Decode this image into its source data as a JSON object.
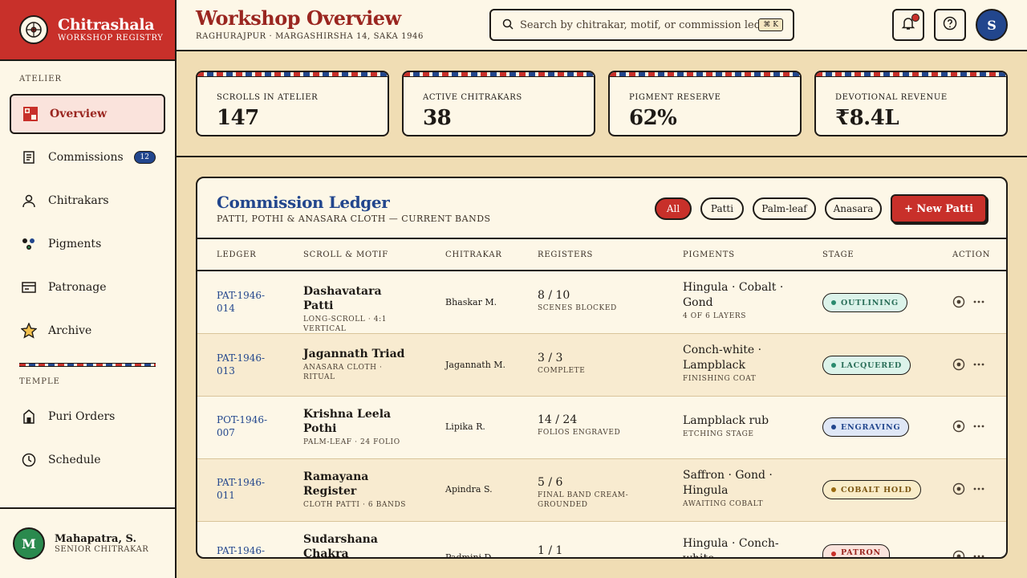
{
  "brand": {
    "title": "Chitrashala",
    "subtitle": "WORKSHOP REGISTRY"
  },
  "sidebar": {
    "section_atelier": "ATELIER",
    "section_temple": "TEMPLE",
    "items": [
      {
        "label": "Overview",
        "icon": "grid-icon"
      },
      {
        "label": "Commissions",
        "icon": "scroll-icon",
        "badge": "12"
      },
      {
        "label": "Chitrakars",
        "icon": "user-icon"
      },
      {
        "label": "Pigments",
        "icon": "pigment-dots-icon"
      },
      {
        "label": "Patronage",
        "icon": "card-icon"
      },
      {
        "label": "Archive",
        "icon": "star-icon"
      },
      {
        "label": "Puri Orders",
        "icon": "temple-icon"
      },
      {
        "label": "Schedule",
        "icon": "clock-icon"
      }
    ],
    "user": {
      "initial": "M",
      "name": "Mahapatra, S.",
      "role": "SENIOR CHITRAKAR"
    }
  },
  "header": {
    "title": "Workshop Overview",
    "subtitle": "RAGHURAJPUR · MARGASHIRSHA 14, SAKA 1946",
    "search_placeholder": "Search by chitrakar, motif, or commission ledger...",
    "search_shortcut": "⌘ K",
    "avatar_initial": "S"
  },
  "stats": [
    {
      "label": "SCROLLS IN ATELIER",
      "value": "147"
    },
    {
      "label": "ACTIVE CHITRAKARS",
      "value": "38"
    },
    {
      "label": "PIGMENT RESERVE",
      "value": "62%"
    },
    {
      "label": "DEVOTIONAL REVENUE",
      "value": "₹8.4L"
    }
  ],
  "ledger": {
    "title": "Commission Ledger",
    "subtitle": "PATTI, POTHI & ANASARA CLOTH — CURRENT BANDS",
    "filters": [
      "All",
      "Patti",
      "Palm-leaf",
      "Anasara"
    ],
    "new_button": "+  New Patti",
    "columns": [
      "LEDGER",
      "SCROLL & MOTIF",
      "CHITRAKAR",
      "REGISTERS",
      "PIGMENTS",
      "STAGE",
      "ACTION"
    ],
    "rows": [
      {
        "id": "PAT-1946-014",
        "scroll": "Dashavatara Patti",
        "motif": "LONG-SCROLL · 4:1 VERTICAL",
        "chitrakar": "Bhaskar M.",
        "registers": "8 / 10",
        "reg_note": "SCENES BLOCKED",
        "pigments": "Hingula · Cobalt · Gond",
        "pig_note": "4 OF 6 LAYERS",
        "stage": "OUTLINING",
        "stage_color": "#2a8a6e",
        "stage_bg": "#dcf3ea"
      },
      {
        "id": "PAT-1946-013",
        "scroll": "Jagannath Triad",
        "motif": "ANASARA CLOTH · RITUAL",
        "chitrakar": "Jagannath M.",
        "registers": "3 / 3",
        "reg_note": "COMPLETE",
        "pigments": "Conch-white · Lampblack",
        "pig_note": "FINISHING COAT",
        "stage": "LACQUERED",
        "stage_color": "#2a8a6e",
        "stage_bg": "#dcf3ea"
      },
      {
        "id": "POT-1946-007",
        "scroll": "Krishna Leela Pothi",
        "motif": "PALM-LEAF · 24 FOLIO",
        "chitrakar": "Lipika R.",
        "registers": "14 / 24",
        "reg_note": "FOLIOS ENGRAVED",
        "pigments": "Lampblack rub",
        "pig_note": "ETCHING STAGE",
        "stage": "ENGRAVING",
        "stage_color": "#22468d",
        "stage_bg": "#dfe7f6"
      },
      {
        "id": "PAT-1946-011",
        "scroll": "Ramayana Register",
        "motif": "CLOTH PATTI · 6 BANDS",
        "chitrakar": "Apindra S.",
        "registers": "5 / 6",
        "reg_note": "FINAL BAND CREAM-GROUNDED",
        "pigments": "Saffron · Gond · Hingula",
        "pig_note": "AWAITING COBALT",
        "stage": "COBALT HOLD",
        "stage_color": "#9a6a10",
        "stage_bg": "#f9ecc8"
      },
      {
        "id": "PAT-1946-",
        "scroll": "Sudarshana Chakra",
        "motif": "",
        "chitrakar": "Padmini D.",
        "registers": "1 / 1",
        "reg_note": "",
        "pigments": "Hingula · Conch-white",
        "pig_note": "",
        "stage": "PATRON",
        "stage_color": "#c8302a",
        "stage_bg": "#fae3dc"
      }
    ]
  }
}
